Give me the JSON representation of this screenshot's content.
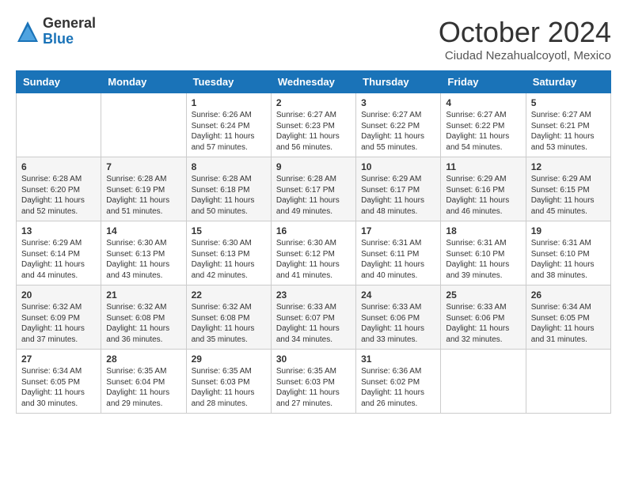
{
  "logo": {
    "general": "General",
    "blue": "Blue"
  },
  "title": "October 2024",
  "subtitle": "Ciudad Nezahualcoyotl, Mexico",
  "days_of_week": [
    "Sunday",
    "Monday",
    "Tuesday",
    "Wednesday",
    "Thursday",
    "Friday",
    "Saturday"
  ],
  "weeks": [
    [
      {
        "day": "",
        "info": ""
      },
      {
        "day": "",
        "info": ""
      },
      {
        "day": "1",
        "info": "Sunrise: 6:26 AM\nSunset: 6:24 PM\nDaylight: 11 hours and 57 minutes."
      },
      {
        "day": "2",
        "info": "Sunrise: 6:27 AM\nSunset: 6:23 PM\nDaylight: 11 hours and 56 minutes."
      },
      {
        "day": "3",
        "info": "Sunrise: 6:27 AM\nSunset: 6:22 PM\nDaylight: 11 hours and 55 minutes."
      },
      {
        "day": "4",
        "info": "Sunrise: 6:27 AM\nSunset: 6:22 PM\nDaylight: 11 hours and 54 minutes."
      },
      {
        "day": "5",
        "info": "Sunrise: 6:27 AM\nSunset: 6:21 PM\nDaylight: 11 hours and 53 minutes."
      }
    ],
    [
      {
        "day": "6",
        "info": "Sunrise: 6:28 AM\nSunset: 6:20 PM\nDaylight: 11 hours and 52 minutes."
      },
      {
        "day": "7",
        "info": "Sunrise: 6:28 AM\nSunset: 6:19 PM\nDaylight: 11 hours and 51 minutes."
      },
      {
        "day": "8",
        "info": "Sunrise: 6:28 AM\nSunset: 6:18 PM\nDaylight: 11 hours and 50 minutes."
      },
      {
        "day": "9",
        "info": "Sunrise: 6:28 AM\nSunset: 6:17 PM\nDaylight: 11 hours and 49 minutes."
      },
      {
        "day": "10",
        "info": "Sunrise: 6:29 AM\nSunset: 6:17 PM\nDaylight: 11 hours and 48 minutes."
      },
      {
        "day": "11",
        "info": "Sunrise: 6:29 AM\nSunset: 6:16 PM\nDaylight: 11 hours and 46 minutes."
      },
      {
        "day": "12",
        "info": "Sunrise: 6:29 AM\nSunset: 6:15 PM\nDaylight: 11 hours and 45 minutes."
      }
    ],
    [
      {
        "day": "13",
        "info": "Sunrise: 6:29 AM\nSunset: 6:14 PM\nDaylight: 11 hours and 44 minutes."
      },
      {
        "day": "14",
        "info": "Sunrise: 6:30 AM\nSunset: 6:13 PM\nDaylight: 11 hours and 43 minutes."
      },
      {
        "day": "15",
        "info": "Sunrise: 6:30 AM\nSunset: 6:13 PM\nDaylight: 11 hours and 42 minutes."
      },
      {
        "day": "16",
        "info": "Sunrise: 6:30 AM\nSunset: 6:12 PM\nDaylight: 11 hours and 41 minutes."
      },
      {
        "day": "17",
        "info": "Sunrise: 6:31 AM\nSunset: 6:11 PM\nDaylight: 11 hours and 40 minutes."
      },
      {
        "day": "18",
        "info": "Sunrise: 6:31 AM\nSunset: 6:10 PM\nDaylight: 11 hours and 39 minutes."
      },
      {
        "day": "19",
        "info": "Sunrise: 6:31 AM\nSunset: 6:10 PM\nDaylight: 11 hours and 38 minutes."
      }
    ],
    [
      {
        "day": "20",
        "info": "Sunrise: 6:32 AM\nSunset: 6:09 PM\nDaylight: 11 hours and 37 minutes."
      },
      {
        "day": "21",
        "info": "Sunrise: 6:32 AM\nSunset: 6:08 PM\nDaylight: 11 hours and 36 minutes."
      },
      {
        "day": "22",
        "info": "Sunrise: 6:32 AM\nSunset: 6:08 PM\nDaylight: 11 hours and 35 minutes."
      },
      {
        "day": "23",
        "info": "Sunrise: 6:33 AM\nSunset: 6:07 PM\nDaylight: 11 hours and 34 minutes."
      },
      {
        "day": "24",
        "info": "Sunrise: 6:33 AM\nSunset: 6:06 PM\nDaylight: 11 hours and 33 minutes."
      },
      {
        "day": "25",
        "info": "Sunrise: 6:33 AM\nSunset: 6:06 PM\nDaylight: 11 hours and 32 minutes."
      },
      {
        "day": "26",
        "info": "Sunrise: 6:34 AM\nSunset: 6:05 PM\nDaylight: 11 hours and 31 minutes."
      }
    ],
    [
      {
        "day": "27",
        "info": "Sunrise: 6:34 AM\nSunset: 6:05 PM\nDaylight: 11 hours and 30 minutes."
      },
      {
        "day": "28",
        "info": "Sunrise: 6:35 AM\nSunset: 6:04 PM\nDaylight: 11 hours and 29 minutes."
      },
      {
        "day": "29",
        "info": "Sunrise: 6:35 AM\nSunset: 6:03 PM\nDaylight: 11 hours and 28 minutes."
      },
      {
        "day": "30",
        "info": "Sunrise: 6:35 AM\nSunset: 6:03 PM\nDaylight: 11 hours and 27 minutes."
      },
      {
        "day": "31",
        "info": "Sunrise: 6:36 AM\nSunset: 6:02 PM\nDaylight: 11 hours and 26 minutes."
      },
      {
        "day": "",
        "info": ""
      },
      {
        "day": "",
        "info": ""
      }
    ]
  ]
}
